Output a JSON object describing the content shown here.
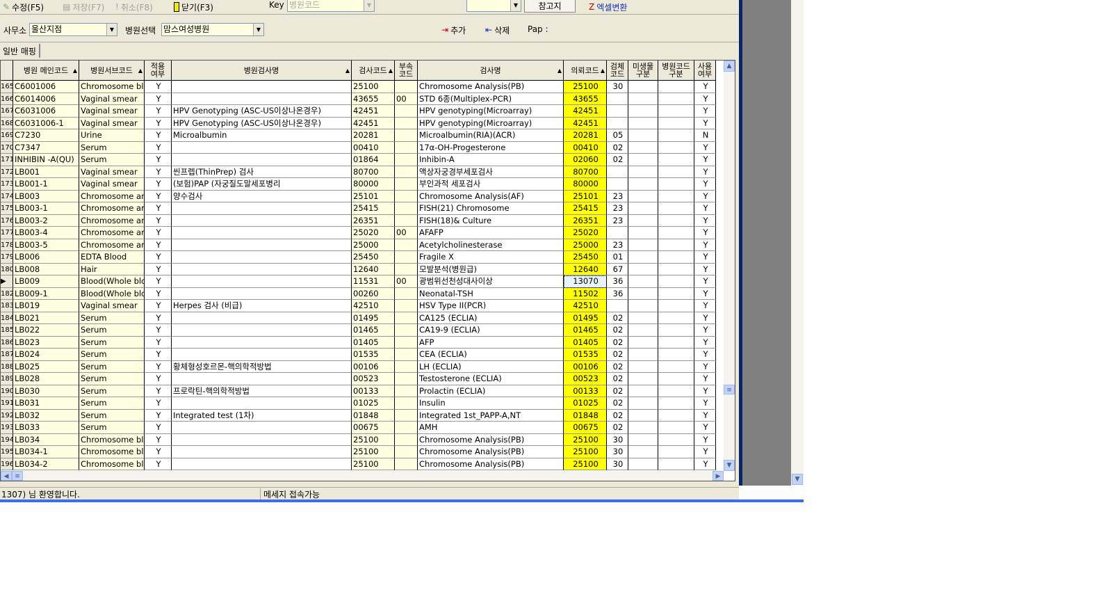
{
  "toolbar": {
    "edit": "수정(F5)",
    "save": "저장(F7)",
    "cancel": "취소(F8)",
    "close": "닫기(F3)",
    "key_label": "Key",
    "key_value": "병원코드",
    "ref_button": "참고지",
    "excel": "엑셀변환"
  },
  "filters": {
    "office_label": "사무소",
    "office_value": "울산지점",
    "hospital_label": "병원선택",
    "hospital_value": "맘스여성병원",
    "add": "추가",
    "delete": "삭제",
    "pap_label": "Pap :"
  },
  "tab": "일반 매핑",
  "columns": [
    "병원 메인코드",
    "병원서브코드",
    "적용\n여부",
    "병원검사명",
    "검사코드",
    "부속\n코드",
    "검사명",
    "의뢰코드",
    "검체\n코드",
    "미생물\n구분",
    "병원코드\n구분",
    "사용\n여부"
  ],
  "rows": [
    [
      "165",
      "C6001006",
      "Chromosome bl",
      "Y",
      "",
      "25100",
      "",
      "Chromosome Analysis(PB)",
      "25100",
      "30",
      "",
      "",
      "Y"
    ],
    [
      "166",
      "C6014006",
      "Vaginal smear",
      "Y",
      "",
      "43655",
      "00",
      "STD 6종(Multiplex-PCR)",
      "43655",
      "",
      "",
      "",
      "Y"
    ],
    [
      "167",
      "C6031006",
      "Vaginal smear",
      "Y",
      "HPV Genotyping (ASC-US이상나온경우)",
      "42451",
      "",
      "HPV genotyping(Microarray)",
      "42451",
      "",
      "",
      "",
      "Y"
    ],
    [
      "168",
      "C6031006-1",
      "Vaginal smear",
      "Y",
      "HPV Genotyping (ASC-US이상나온경우)",
      "42451",
      "",
      "HPV genotyping(Microarray)",
      "42451",
      "",
      "",
      "",
      "Y"
    ],
    [
      "169",
      "C7230",
      "Urine",
      "Y",
      "Microalbumin",
      "20281",
      "",
      "Microalbumin(RIA)(ACR)",
      "20281",
      "05",
      "",
      "",
      "N"
    ],
    [
      "170",
      "C7347",
      "Serum",
      "Y",
      "",
      "00410",
      "",
      "17α-OH-Progesterone",
      "00410",
      "02",
      "",
      "",
      "Y"
    ],
    [
      "171",
      "INHIBIN -A(QU)",
      "Serum",
      "Y",
      "",
      "01864",
      "",
      "Inhibin-A",
      "02060",
      "02",
      "",
      "",
      "Y"
    ],
    [
      "172",
      "LB001",
      "Vaginal smear",
      "Y",
      "씬프렙(ThinPrep) 검사",
      "80700",
      "",
      "액상자궁경부세포검사",
      "80700",
      "",
      "",
      "",
      "Y"
    ],
    [
      "173",
      "LB001-1",
      "Vaginal smear",
      "Y",
      "(보험)PAP (자궁질도말세포병리",
      "80000",
      "",
      "부인과적   세포검사",
      "80000",
      "",
      "",
      "",
      "Y"
    ],
    [
      "174",
      "LB003",
      "Chromosome ar",
      "Y",
      "양수검사",
      "25101",
      "",
      "Chromosome Analysis(AF)",
      "25101",
      "23",
      "",
      "",
      "Y"
    ],
    [
      "175",
      "LB003-1",
      "Chromosome ar",
      "Y",
      "",
      "25415",
      "",
      "FISH(21) Chromosome",
      "25415",
      "23",
      "",
      "",
      "Y"
    ],
    [
      "176",
      "LB003-2",
      "Chromosome ar",
      "Y",
      "",
      "26351",
      "",
      "FISH(18)& Culture",
      "26351",
      "23",
      "",
      "",
      "Y"
    ],
    [
      "177",
      "LB003-4",
      "Chromosome ar",
      "Y",
      "",
      "25020",
      "00",
      "AFAFP",
      "25020",
      "",
      "",
      "",
      "Y"
    ],
    [
      "178",
      "LB003-5",
      "Chromosome ar",
      "Y",
      "",
      "25000",
      "",
      "Acetylcholinesterase",
      "25000",
      "23",
      "",
      "",
      "Y"
    ],
    [
      "179",
      "LB006",
      "EDTA Blood",
      "Y",
      "",
      "25450",
      "",
      "Fragile X",
      "25450",
      "01",
      "",
      "",
      "Y"
    ],
    [
      "180",
      "LB008",
      "Hair",
      "Y",
      "",
      "12640",
      "",
      "모발분석(병원급)",
      "12640",
      "67",
      "",
      "",
      "Y"
    ],
    [
      "▶",
      "LB009",
      "Blood(Whole blo",
      "Y",
      "",
      "11531",
      "00",
      "광범위선천성대사이상",
      "13070",
      "36",
      "",
      "",
      "Y"
    ],
    [
      "182",
      "LB009-1",
      "Blood(Whole blo",
      "Y",
      "",
      "00260",
      "",
      "Neonatal-TSH",
      "11502",
      "36",
      "",
      "",
      "Y"
    ],
    [
      "183",
      "LB019",
      "Vaginal smear",
      "Y",
      "Herpes 검사 (비급)",
      "42510",
      "",
      "HSV Type II(PCR)",
      "42510",
      "",
      "",
      "",
      "Y"
    ],
    [
      "184",
      "LB021",
      "Serum",
      "Y",
      "",
      "01495",
      "",
      "CA125 (ECLIA)",
      "01495",
      "02",
      "",
      "",
      "Y"
    ],
    [
      "185",
      "LB022",
      "Serum",
      "Y",
      "",
      "01465",
      "",
      "CA19-9 (ECLIA)",
      "01465",
      "02",
      "",
      "",
      "Y"
    ],
    [
      "186",
      "LB023",
      "Serum",
      "Y",
      "",
      "01405",
      "",
      "AFP",
      "01405",
      "02",
      "",
      "",
      "Y"
    ],
    [
      "187",
      "LB024",
      "Serum",
      "Y",
      "",
      "01535",
      "",
      "CEA (ECLIA)",
      "01535",
      "02",
      "",
      "",
      "Y"
    ],
    [
      "188",
      "LB025",
      "Serum",
      "Y",
      "황체형성호르몬-핵의학적방법",
      "00106",
      "",
      "LH (ECLIA)",
      "00106",
      "02",
      "",
      "",
      "Y"
    ],
    [
      "189",
      "LB028",
      "Serum",
      "Y",
      "",
      "00523",
      "",
      "Testosterone (ECLIA)",
      "00523",
      "02",
      "",
      "",
      "Y"
    ],
    [
      "190",
      "LB030",
      "Serum",
      "Y",
      "프로락틴-핵의학적방법",
      "00133",
      "",
      "Prolactin (ECLIA)",
      "00133",
      "02",
      "",
      "",
      "Y"
    ],
    [
      "191",
      "LB031",
      "Serum",
      "Y",
      "",
      "01025",
      "",
      "Insulin",
      "01025",
      "02",
      "",
      "",
      "Y"
    ],
    [
      "192",
      "LB032",
      "Serum",
      "Y",
      "Integrated test (1차)",
      "01848",
      "",
      "Integrated 1st_PAPP-A,NT",
      "01848",
      "02",
      "",
      "",
      "Y"
    ],
    [
      "193",
      "LB033",
      "Serum",
      "Y",
      "",
      "00675",
      "",
      "AMH",
      "00675",
      "02",
      "",
      "",
      "Y"
    ],
    [
      "194",
      "LB034",
      "Chromosome bl",
      "Y",
      "",
      "25100",
      "",
      "Chromosome Analysis(PB)",
      "25100",
      "30",
      "",
      "",
      "Y"
    ],
    [
      "195",
      "LB034-1",
      "Chromosome bl",
      "Y",
      "",
      "25100",
      "",
      "Chromosome Analysis(PB)",
      "25100",
      "30",
      "",
      "",
      "Y"
    ],
    [
      "196",
      "LB034-2",
      "Chromosome bl",
      "Y",
      "",
      "25100",
      "",
      "Chromosome Analysis(PB)",
      "25100",
      "30",
      "",
      "",
      "Y"
    ]
  ],
  "selected_row": 16,
  "status": {
    "welcome": "1307) 님 환영합니다.",
    "message": "메세지 접속가능"
  },
  "colors": {
    "highlight": "#ffff00",
    "readonly": "#ffffe1",
    "selected_cell": "#e8f4fc"
  }
}
